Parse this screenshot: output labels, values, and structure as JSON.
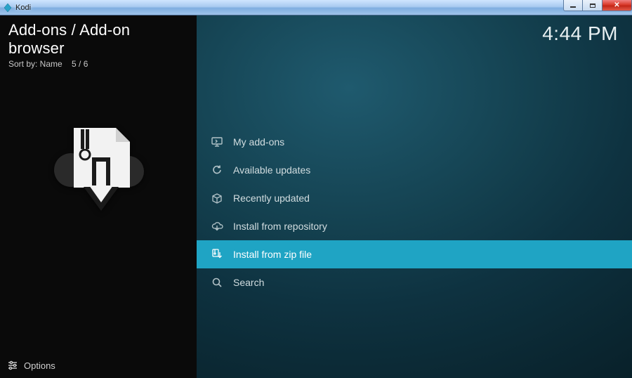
{
  "window": {
    "app_title": "Kodi"
  },
  "header": {
    "title": "Add-ons / Add-on browser",
    "sort_label": "Sort by: Name",
    "position": "5 / 6"
  },
  "time": "4:44 PM",
  "menu": {
    "items": [
      {
        "icon": "monitor-icon",
        "label": "My add-ons",
        "selected": false
      },
      {
        "icon": "refresh-icon",
        "label": "Available updates",
        "selected": false
      },
      {
        "icon": "box-open-icon",
        "label": "Recently updated",
        "selected": false
      },
      {
        "icon": "cloud-down-icon",
        "label": "Install from repository",
        "selected": false
      },
      {
        "icon": "zip-down-icon",
        "label": "Install from zip file",
        "selected": true
      },
      {
        "icon": "search-icon",
        "label": "Search",
        "selected": false
      }
    ]
  },
  "footer": {
    "options_label": "Options"
  }
}
